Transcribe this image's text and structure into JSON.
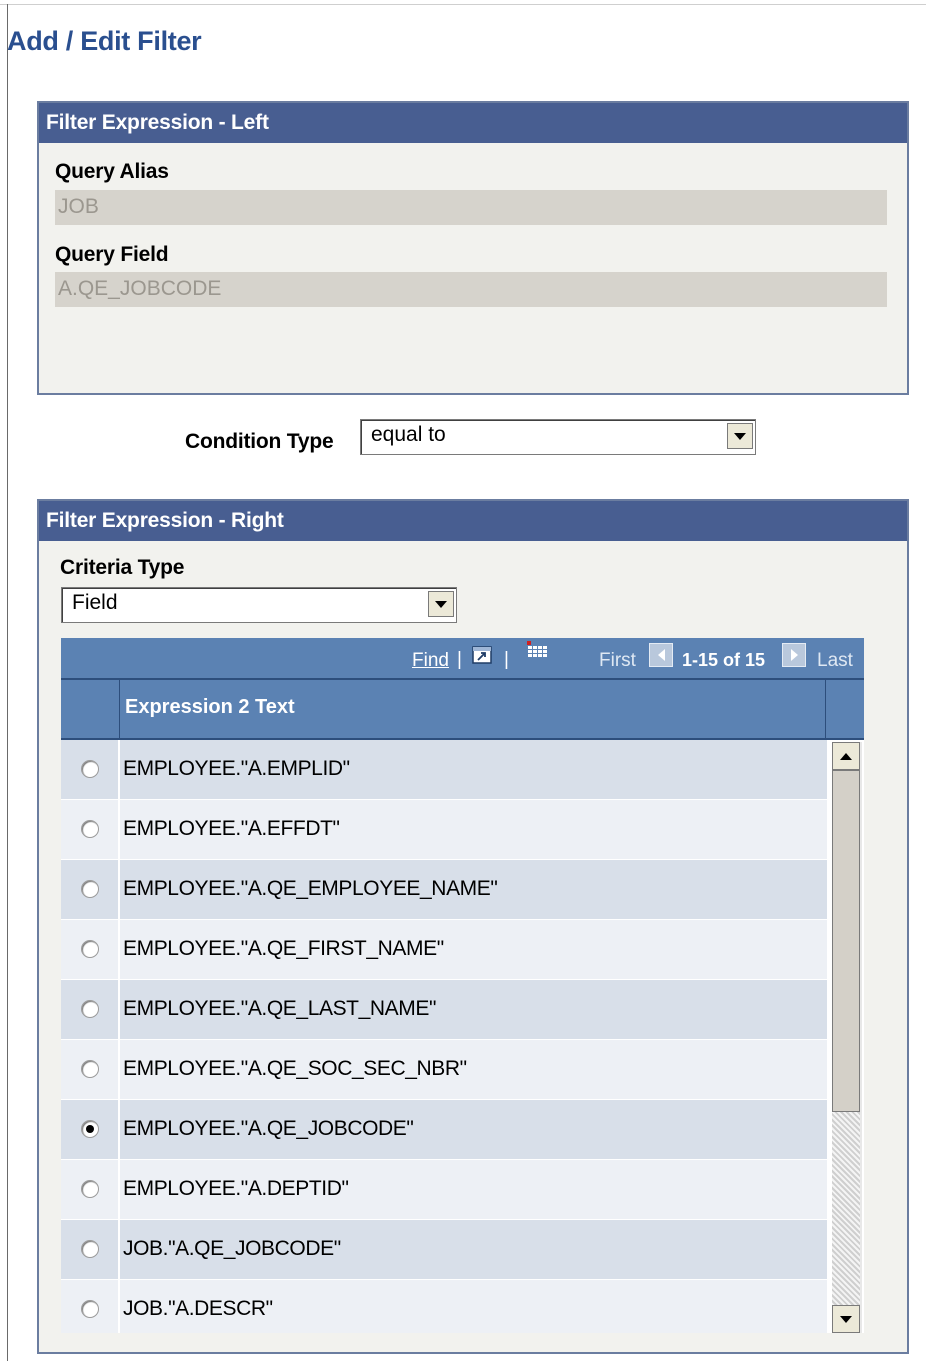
{
  "page": {
    "title": "Add / Edit Filter"
  },
  "left_group": {
    "header": "Filter Expression - Left",
    "query_alias_label": "Query Alias",
    "query_alias_value": "JOB",
    "query_field_label": "Query Field",
    "query_field_value": "A.QE_JOBCODE"
  },
  "condition": {
    "label": "Condition Type",
    "value": "equal to"
  },
  "right_group": {
    "header": "Filter Expression - Right",
    "criteria_label": "Criteria Type",
    "criteria_value": "Field"
  },
  "grid": {
    "nav": {
      "find": "Find",
      "sep": "|",
      "first": "First",
      "count": "1-15 of 15",
      "last": "Last"
    },
    "column_header": "Expression 2 Text",
    "selected_index": 6,
    "rows": [
      "EMPLOYEE.\"A.EMPLID\"",
      "EMPLOYEE.\"A.EFFDT\"",
      "EMPLOYEE.\"A.QE_EMPLOYEE_NAME\"",
      "EMPLOYEE.\"A.QE_FIRST_NAME\"",
      "EMPLOYEE.\"A.QE_LAST_NAME\"",
      "EMPLOYEE.\"A.QE_SOC_SEC_NBR\"",
      "EMPLOYEE.\"A.QE_JOBCODE\"",
      "EMPLOYEE.\"A.DEPTID\"",
      "JOB.\"A.QE_JOBCODE\"",
      "JOB.\"A.DESCR\""
    ]
  },
  "icons": {
    "zoom": "zoom-icon",
    "grid_download": "spreadsheet-icon",
    "prev": "previous-arrow-icon",
    "next": "next-arrow-icon"
  },
  "colors": {
    "title": "#2a4f8f",
    "group_header": "#485e91",
    "grid_header": "#5b82b3",
    "row_odd": "#d8dfe9",
    "row_even": "#edf0f5"
  }
}
